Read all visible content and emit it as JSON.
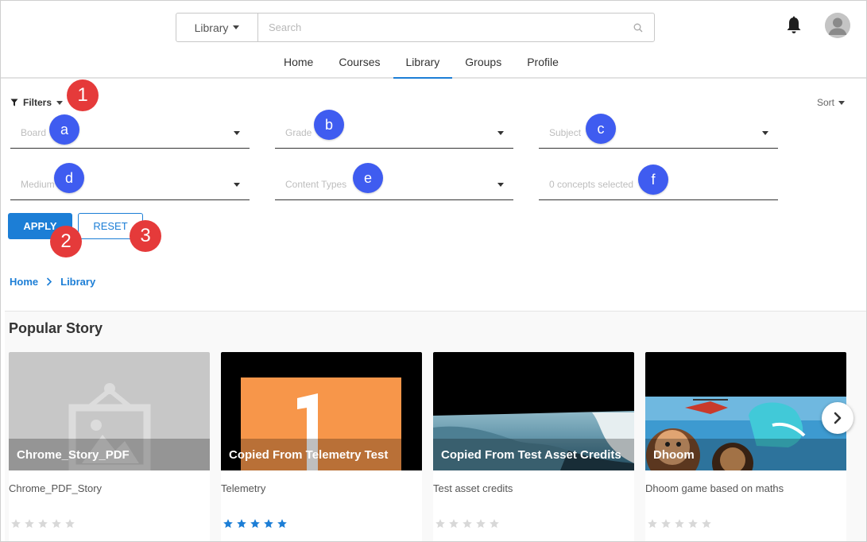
{
  "header": {
    "search_scope": "Library",
    "search_placeholder": "Search",
    "nav": [
      "Home",
      "Courses",
      "Library",
      "Groups",
      "Profile"
    ],
    "active_nav": "Library"
  },
  "filters": {
    "toggle_label": "Filters",
    "sort_label": "Sort",
    "board": "Board",
    "grade": "Grade",
    "subject": "Subject",
    "medium": "Medium",
    "content_types": "Content Types",
    "concepts": "0 concepts selected",
    "apply": "APPLY",
    "reset": "RESET"
  },
  "annotations": {
    "n1": "1",
    "n2": "2",
    "n3": "3",
    "a": "a",
    "b": "b",
    "c": "c",
    "d": "d",
    "e": "e",
    "f": "f"
  },
  "breadcrumb": {
    "home": "Home",
    "library": "Library"
  },
  "section": {
    "title": "Popular Story"
  },
  "cards": [
    {
      "title": "Chrome_Story_PDF",
      "description": "Chrome_PDF_Story",
      "rating": 0
    },
    {
      "title": "Copied From Telemetry Test",
      "description": "Telemetry",
      "rating": 5
    },
    {
      "title": "Copied From Test Asset Credits",
      "description": "Test asset credits",
      "rating": 0
    },
    {
      "title": "Dhoom",
      "description": "Dhoom game based on maths",
      "rating": 0
    }
  ],
  "colors": {
    "accent": "#1c7ed6",
    "annotation_red": "#e53a3a",
    "annotation_blue": "#3f5cf0"
  },
  "icons": {
    "bell": "bell-icon",
    "avatar": "user-avatar-icon",
    "search": "search-icon",
    "filter": "funnel-icon",
    "next": "chevron-right-icon"
  }
}
